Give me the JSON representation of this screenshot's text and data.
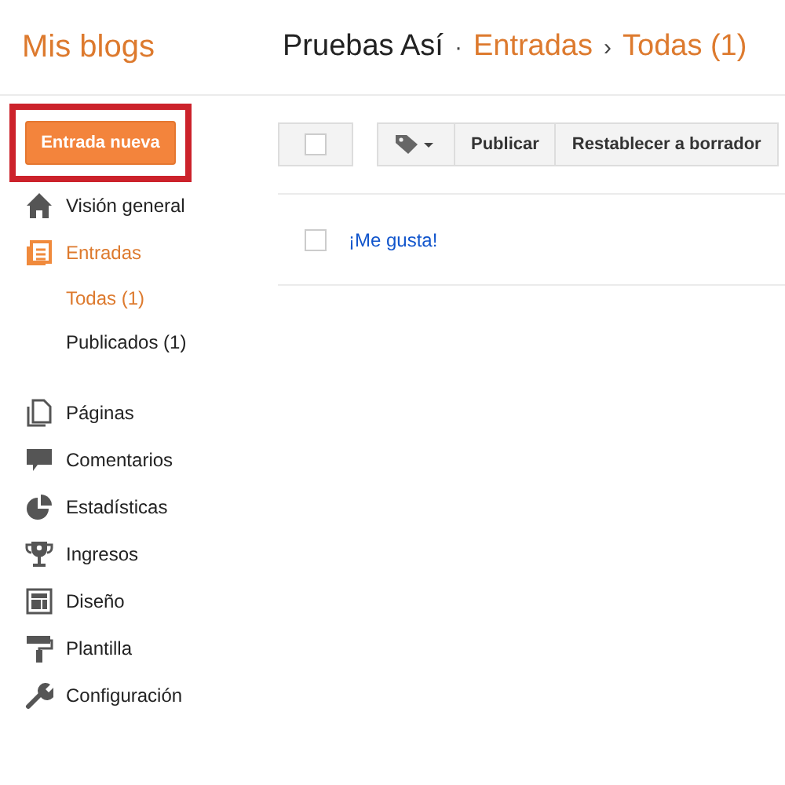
{
  "brand": "Mis blogs",
  "breadcrumb": {
    "blog": "Pruebas Así",
    "dot": "·",
    "section": "Entradas",
    "arrow": "›",
    "view": "Todas (1)"
  },
  "new_post_button": "Entrada nueva",
  "nav": [
    {
      "label": "Visión general",
      "selected": false
    },
    {
      "label": "Entradas",
      "selected": true,
      "children": [
        {
          "label": "Todas (1)",
          "selected": true
        },
        {
          "label": "Publicados (1)",
          "selected": false
        }
      ]
    },
    {
      "label": "Páginas",
      "selected": false
    },
    {
      "label": "Comentarios",
      "selected": false
    },
    {
      "label": "Estadísticas",
      "selected": false
    },
    {
      "label": "Ingresos",
      "selected": false
    },
    {
      "label": "Diseño",
      "selected": false
    },
    {
      "label": "Plantilla",
      "selected": false
    },
    {
      "label": "Configuración",
      "selected": false
    }
  ],
  "toolbar": {
    "select_all_checked": false,
    "buttons": [
      "Publicar",
      "Restablecer a borrador"
    ]
  },
  "posts": [
    {
      "title": "¡Me gusta!",
      "checked": false
    }
  ]
}
